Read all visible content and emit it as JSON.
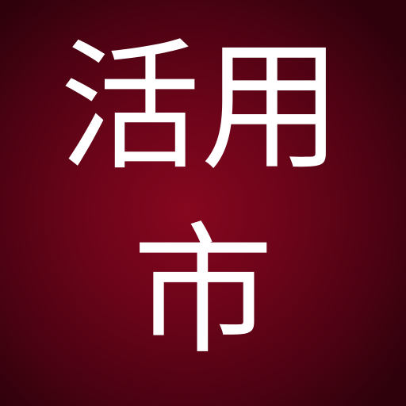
{
  "logo": {
    "line1": [
      "活",
      "用"
    ],
    "line2": [
      "市"
    ]
  },
  "colors": {
    "background_center": "#86071f",
    "background_edge": "#2e010b",
    "text": "#ffffff"
  }
}
